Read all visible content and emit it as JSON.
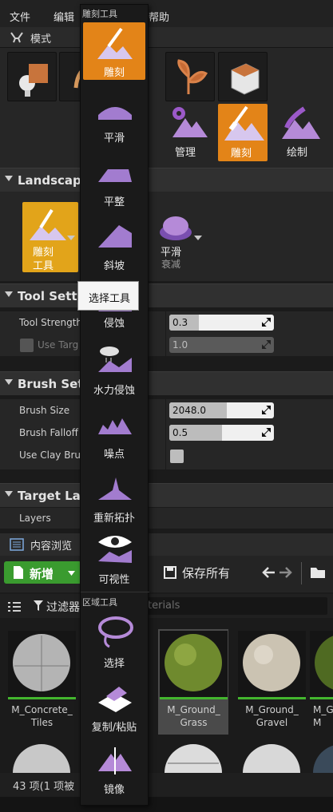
{
  "menubar": {
    "file": "文件",
    "edit": "编辑",
    "help": "帮助"
  },
  "modes": {
    "title": "模式"
  },
  "tool_tabs": [
    {
      "label": "管理",
      "active": false
    },
    {
      "label": "雕刻",
      "active": true
    },
    {
      "label": "绘制",
      "active": false
    }
  ],
  "landscape_section": {
    "title": "Landscape"
  },
  "tool_selector": {
    "tool_label_1": "雕刻",
    "tool_label_2": "工具",
    "falloff_label_1": "平滑",
    "falloff_label_2": "衰减"
  },
  "tool_settings": {
    "title": "Tool Setti",
    "strength_label": "Tool Strength",
    "strength_value": "0.3",
    "strength_fraction": 0.28,
    "use_target_label": "Use Targ",
    "use_target_value": "1.0"
  },
  "brush_settings": {
    "title": "Brush Set",
    "size_label": "Brush Size",
    "size_value": "2048.0",
    "size_fraction": 0.55,
    "falloff_label": "Brush Falloff",
    "falloff_value": "0.5",
    "falloff_fraction": 0.5,
    "clay_label": "Use Clay Bru"
  },
  "target_layers": {
    "title": "Target Lay",
    "layers_label": "Layers"
  },
  "dropdown": {
    "heading_sculpt": "雕刻工具",
    "heading_region": "区域工具",
    "items": [
      "雕刻",
      "平滑",
      "平整",
      "斜坡",
      "侵蚀",
      "水力侵蚀",
      "噪点",
      "重新拓扑",
      "可视性",
      "选择",
      "复制/粘贴",
      "镜像"
    ]
  },
  "tooltip": "选择工具",
  "content_browser": {
    "tab_title": "内容浏览",
    "new_button": "新增",
    "save_all": "保存所有",
    "filters": "过滤器",
    "search_placeholder": "terials",
    "assets": [
      {
        "name_1": "M_Concrete_",
        "name_2": "Tiles",
        "selected": false
      },
      {
        "name_1": "M_Ground_",
        "name_2": "Grass",
        "selected": true
      },
      {
        "name_1": "M_Ground_",
        "name_2": "Gravel",
        "selected": false
      },
      {
        "name_1": "M_G",
        "name_2": "M",
        "selected": false
      }
    ],
    "status": "43 项(1 项被"
  }
}
